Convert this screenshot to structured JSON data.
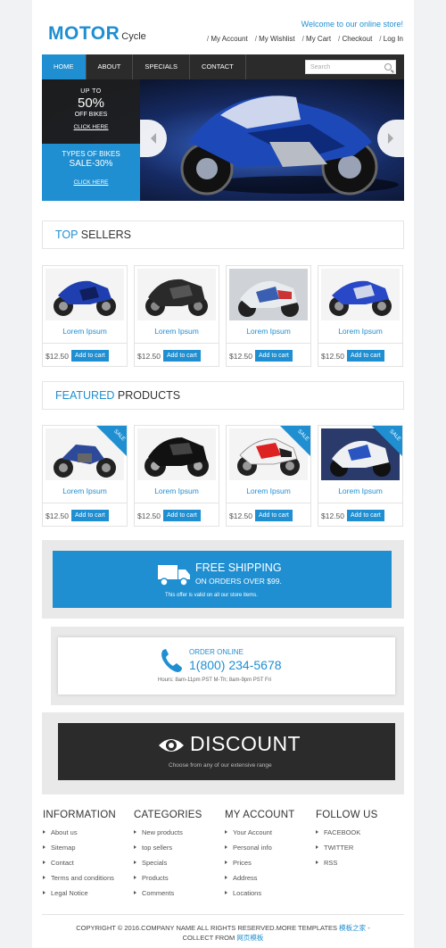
{
  "header": {
    "logo_main": "MOTOR",
    "logo_sub": "Cycle",
    "welcome": "Welcome to our online store!",
    "links": [
      "My Account",
      "My Wishlist",
      "My Cart",
      "Checkout",
      "Log In"
    ]
  },
  "nav": {
    "items": [
      "HOME",
      "ABOUT",
      "SPECIALS",
      "CONTACT"
    ],
    "active": "HOME",
    "search_placeholder": "Search"
  },
  "slider": {
    "promo1": {
      "line1": "UP TO",
      "line2": "50%",
      "line3": "OFF BIKES",
      "link": "CLICK HERE"
    },
    "promo2": {
      "line1": "TYPES OF BIKES",
      "line2": "SALE-30%",
      "link": "CLICK HERE"
    }
  },
  "top_sellers": {
    "title_highlight": "TOP",
    "title_rest": "SELLERS",
    "products": [
      {
        "name": "Lorem Ipsum",
        "price": "$12.50",
        "button": "Add to cart"
      },
      {
        "name": "Lorem Ipsum",
        "price": "$12.50",
        "button": "Add to cart"
      },
      {
        "name": "Lorem Ipsum",
        "price": "$12.50",
        "button": "Add to cart"
      },
      {
        "name": "Lorem Ipsum",
        "price": "$12.50",
        "button": "Add to cart"
      }
    ]
  },
  "featured": {
    "title_highlight": "FEATURED",
    "title_rest": "PRODUCTS",
    "sale_label": "SALE",
    "products": [
      {
        "name": "Lorem Ipsum",
        "price": "$12.50",
        "button": "Add to cart",
        "sale": true
      },
      {
        "name": "Lorem Ipsum",
        "price": "$12.50",
        "button": "Add to cart",
        "sale": false
      },
      {
        "name": "Lorem Ipsum",
        "price": "$12.50",
        "button": "Add to cart",
        "sale": true
      },
      {
        "name": "Lorem Ipsum",
        "price": "$12.50",
        "button": "Add to cart",
        "sale": true
      }
    ]
  },
  "shipping": {
    "title": "FREE SHIPPING",
    "subtitle": "ON ORDERS OVER $99.",
    "note": "This offer is valid on all our store items."
  },
  "order": {
    "title": "ORDER ONLINE",
    "phone": "1(800) 234-5678",
    "hours": "Hours: 8am-11pm PST M-Th; 8am-9pm PST Fri"
  },
  "discount": {
    "title": "DISCOUNT",
    "subtitle": "Choose from any of our extensive range"
  },
  "footer": {
    "information": {
      "title": "INFORMATION",
      "items": [
        "About us",
        "Sitemap",
        "Contact",
        "Terms and conditions",
        "Legal Notice"
      ]
    },
    "categories": {
      "title": "CATEGORIES",
      "items": [
        "New products",
        "top sellers",
        "Specials",
        "Products",
        "Comments"
      ]
    },
    "account": {
      "title": "MY ACCOUNT",
      "items": [
        "Your Account",
        "Personal info",
        "Prices",
        "Address",
        "Locations"
      ]
    },
    "follow": {
      "title": "FOLLOW US",
      "items": [
        "FACEBOOK",
        "TWITTER",
        "RSS"
      ]
    },
    "copyright_line1": "COPYRIGHT © 2016.COMPANY NAME ALL RIGHTS RESERVED.MORE TEMPLATES",
    "copyright_link1": "模板之家",
    "copyright_sep": " -",
    "copyright_line2": "COLLECT FROM",
    "copyright_link2": "网页模板"
  },
  "colors": {
    "accent": "#1f8fd1",
    "dark": "#2b2b2b"
  }
}
